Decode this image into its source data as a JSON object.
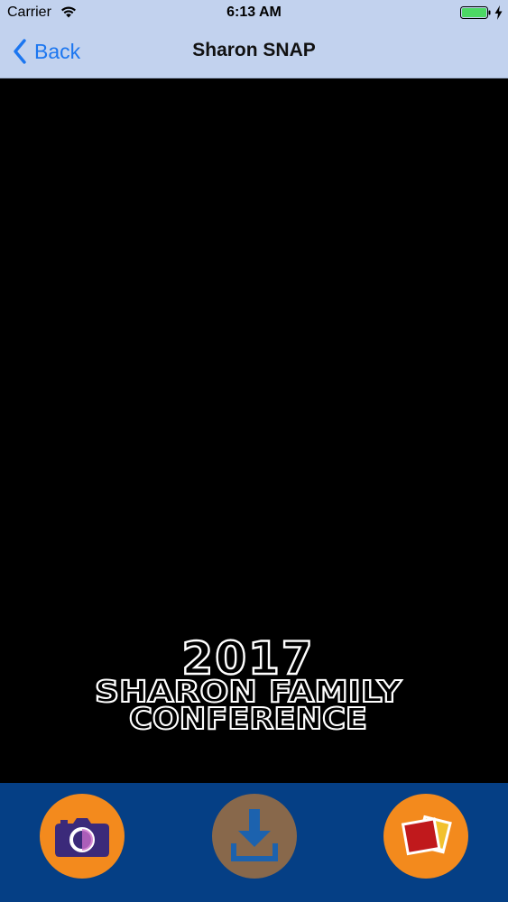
{
  "status_bar": {
    "carrier": "Carrier",
    "time": "6:13 AM",
    "wifi_icon": "wifi-icon",
    "battery_icon": "battery-icon",
    "charging_icon": "charging-bolt-icon"
  },
  "nav": {
    "back_label": "Back",
    "title": "Sharon SNAP",
    "back_icon": "chevron-left-icon"
  },
  "overlay": {
    "year": "2017",
    "line1": "SHARON FAMILY",
    "line2": "CONFERENCE"
  },
  "toolbar": {
    "buttons": [
      {
        "icon": "camera-icon",
        "enabled": true
      },
      {
        "icon": "download-icon",
        "enabled": false
      },
      {
        "icon": "photos-icon",
        "enabled": true
      }
    ]
  },
  "colors": {
    "nav_background": "#c2d2ee",
    "accent_blue": "#1b76f0",
    "toolbar_background": "#053f85",
    "button_orange": "#f38a1d",
    "battery_green": "#4cd964",
    "camera_purple": "#3b2a7a",
    "download_blue": "#2f7fd0"
  }
}
